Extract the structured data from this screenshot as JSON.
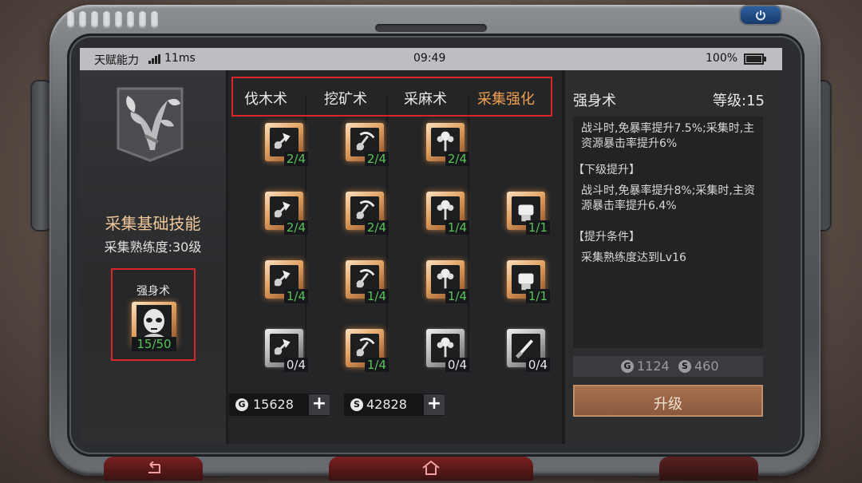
{
  "status_bar": {
    "carrier": "天赋能力",
    "latency": "11ms",
    "time": "09:49",
    "battery": "100%"
  },
  "left": {
    "category_title": "采集基础技能",
    "proficiency": "采集熟练度:30级",
    "selected_skill": {
      "name": "强身术",
      "count": "15/50"
    }
  },
  "tabs": [
    {
      "label": "伐木术",
      "active": false
    },
    {
      "label": "挖矿术",
      "active": false
    },
    {
      "label": "采麻术",
      "active": false
    },
    {
      "label": "采集强化",
      "active": true
    }
  ],
  "skills": [
    {
      "icon": "axe-hand-icon",
      "count": "2/4",
      "active": true
    },
    {
      "icon": "pickaxe-hand-icon",
      "count": "2/4",
      "active": true
    },
    {
      "icon": "flower-hand-icon",
      "count": "2/4",
      "active": true
    },
    {
      "icon": "axe-hand-icon",
      "count": "2/4",
      "active": true
    },
    {
      "icon": "pickaxe-hand-icon",
      "count": "2/4",
      "active": true
    },
    {
      "icon": "flower-hand-icon",
      "count": "1/4",
      "active": true
    },
    {
      "icon": "fist-icon",
      "count": "1/1",
      "active": true
    },
    {
      "icon": "axe-hand-icon",
      "count": "1/4",
      "active": true
    },
    {
      "icon": "pickaxe-hand-icon",
      "count": "1/4",
      "active": true
    },
    {
      "icon": "flower-hand-icon",
      "count": "1/4",
      "active": true
    },
    {
      "icon": "fist-icon",
      "count": "1/1",
      "active": true
    },
    {
      "icon": "axe-hand-icon",
      "count": "0/4",
      "active": false
    },
    {
      "icon": "pickaxe-hand-icon",
      "count": "1/4",
      "active": true
    },
    {
      "icon": "flower-hand-icon",
      "count": "0/4",
      "active": false
    },
    {
      "icon": "knife-icon",
      "count": "0/4",
      "active": false
    }
  ],
  "resources": {
    "gold": "15628",
    "silver": "42828",
    "gold_icon": "G",
    "silver_icon": "S",
    "plus": "+"
  },
  "detail": {
    "name": "强身术",
    "level": "等级:15",
    "current_desc": "战斗时,免暴率提升7.5%;采集时,主资源暴击率提升6%",
    "next_header": "【下级提升】",
    "next_desc": "战斗时,免暴率提升8%;采集时,主资源暴击率提升6.4%",
    "cond_header": "【提升条件】",
    "cond_desc": "采集熟练度达到Lv16",
    "cost_gold": "1124",
    "cost_silver": "460",
    "upgrade_label": "升级"
  },
  "colors": {
    "accent": "#f0a050",
    "highlight_border": "#d9262a",
    "count_green": "#59c25a"
  }
}
